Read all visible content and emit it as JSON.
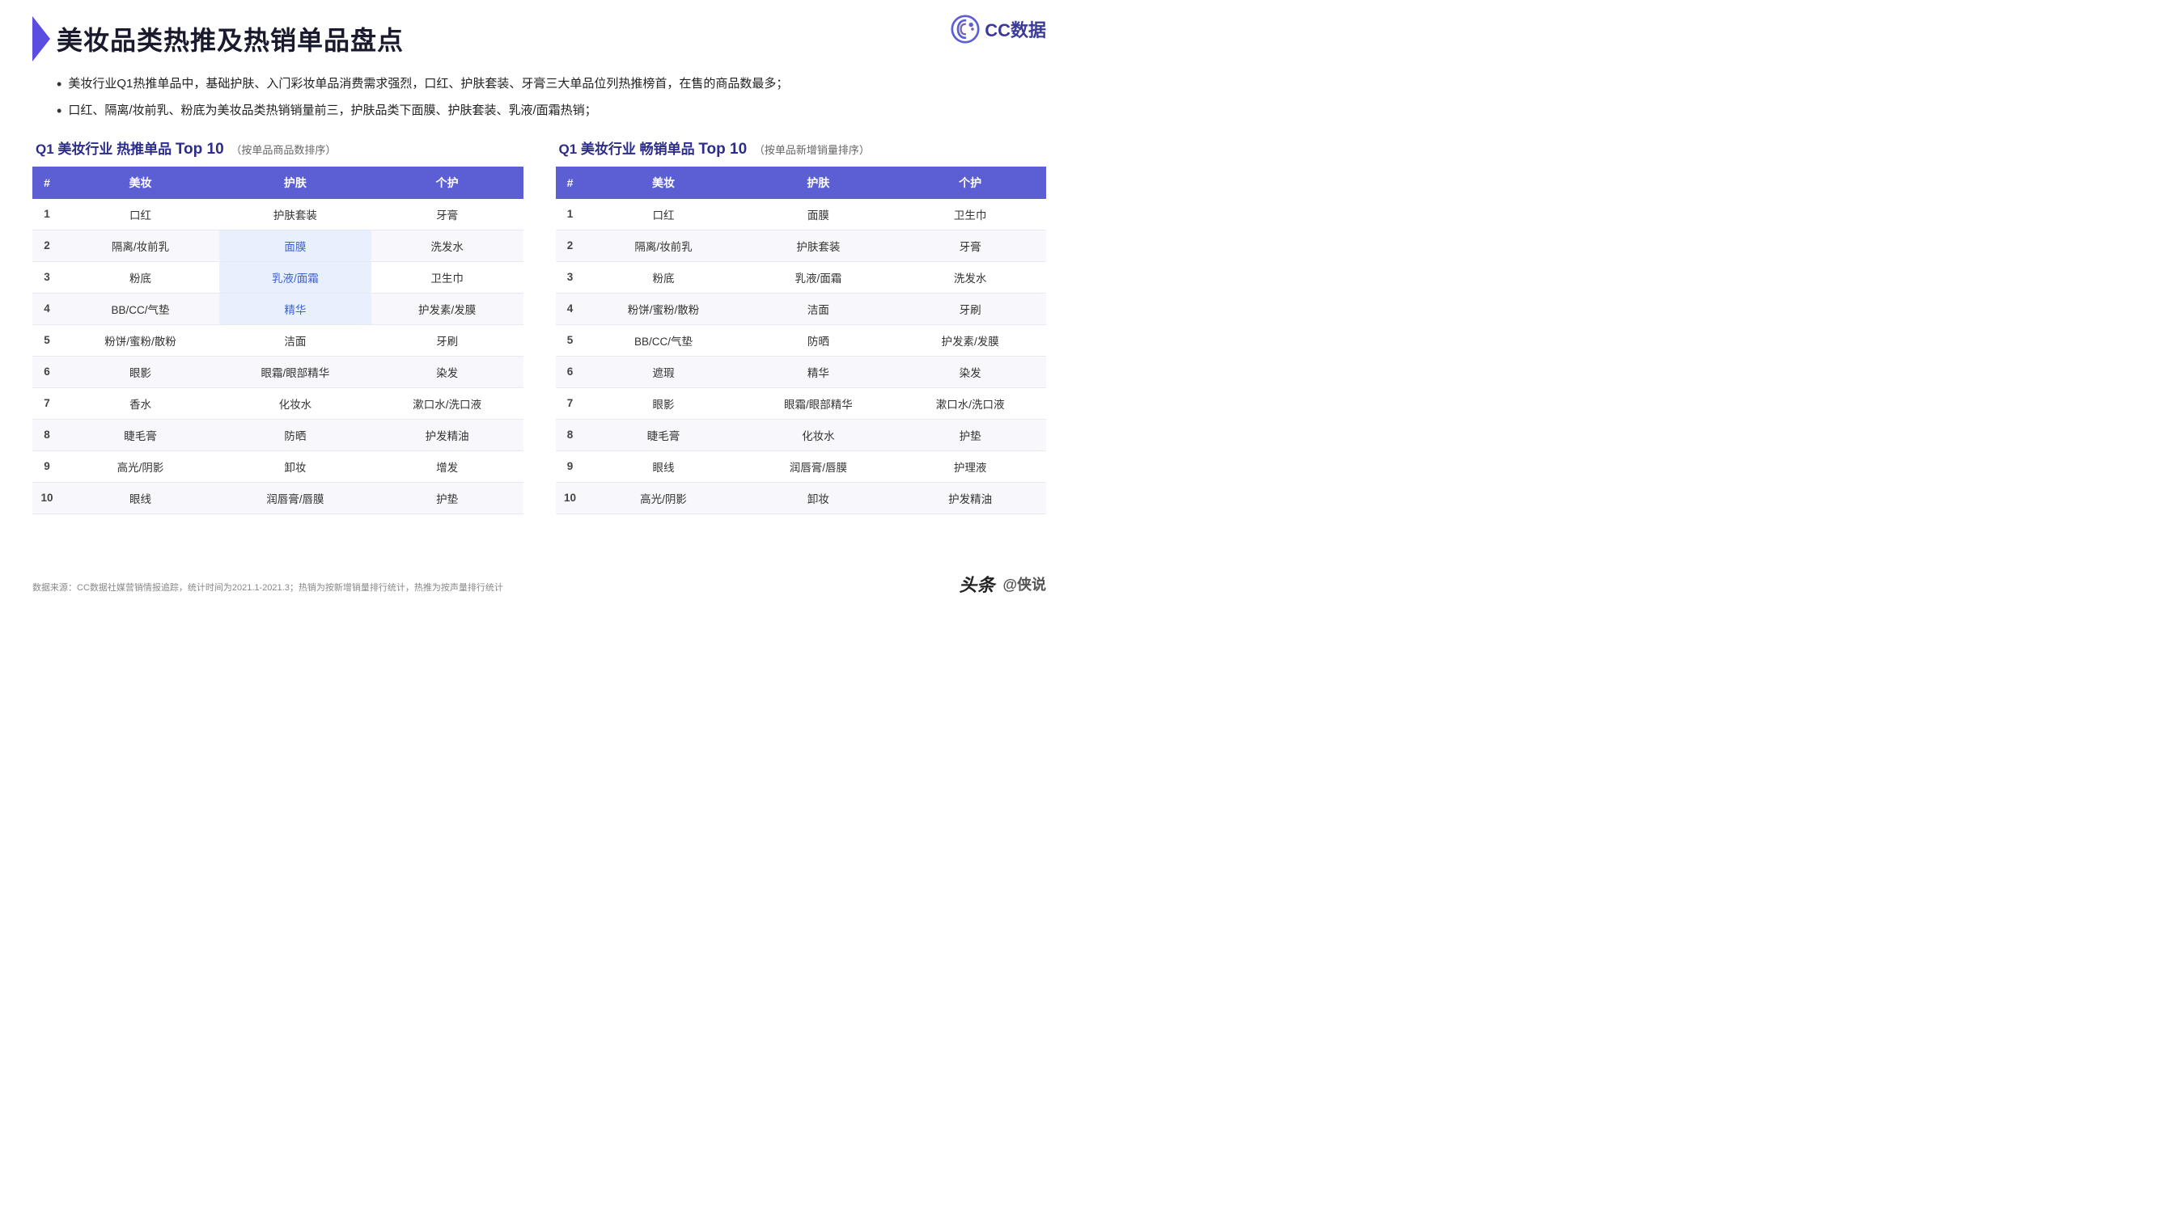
{
  "logo": {
    "text": "CC数据",
    "icon": "CC"
  },
  "title": "美妆品类热推及热销单品盘点",
  "bullets": [
    "美妆行业Q1热推单品中，基础护肤、入门彩妆单品消费需求强烈，口红、护肤套装、牙膏三大单品位列热推榜首，在售的商品数最多；",
    "口红、隔离/妆前乳、粉底为美妆品类热销销量前三，护肤品类下面膜、护肤套装、乳液/面霜热销；"
  ],
  "table1": {
    "title_prefix": "Q1 美妆行业 热推单品",
    "title_highlight": "Top 10",
    "title_sub": "（按单品商品数排序）",
    "headers": [
      "#",
      "美妆",
      "护肤",
      "个护"
    ],
    "rows": [
      {
        "rank": "1",
        "col1": "口红",
        "col2": "护肤套装",
        "col3": "牙膏",
        "highlight": []
      },
      {
        "rank": "2",
        "col1": "隔离/妆前乳",
        "col2": "面膜",
        "col3": "洗发水",
        "highlight": [
          "col2"
        ]
      },
      {
        "rank": "3",
        "col1": "粉底",
        "col2": "乳液/面霜",
        "col3": "卫生巾",
        "highlight": [
          "col2"
        ]
      },
      {
        "rank": "4",
        "col1": "BB/CC/气垫",
        "col2": "精华",
        "col3": "护发素/发膜",
        "highlight": [
          "col2"
        ]
      },
      {
        "rank": "5",
        "col1": "粉饼/蜜粉/散粉",
        "col2": "洁面",
        "col3": "牙刷",
        "highlight": []
      },
      {
        "rank": "6",
        "col1": "眼影",
        "col2": "眼霜/眼部精华",
        "col3": "染发",
        "highlight": []
      },
      {
        "rank": "7",
        "col1": "香水",
        "col2": "化妆水",
        "col3": "漱口水/洗口液",
        "highlight": []
      },
      {
        "rank": "8",
        "col1": "睫毛膏",
        "col2": "防晒",
        "col3": "护发精油",
        "highlight": []
      },
      {
        "rank": "9",
        "col1": "高光/阴影",
        "col2": "卸妆",
        "col3": "增发",
        "highlight": []
      },
      {
        "rank": "10",
        "col1": "眼线",
        "col2": "润唇膏/唇膜",
        "col3": "护垫",
        "highlight": []
      }
    ]
  },
  "table2": {
    "title_prefix": "Q1 美妆行业 畅销单品",
    "title_highlight": "Top 10",
    "title_sub": "（按单品新增销量排序）",
    "headers": [
      "#",
      "美妆",
      "护肤",
      "个护"
    ],
    "rows": [
      {
        "rank": "1",
        "col1": "口红",
        "col2": "面膜",
        "col3": "卫生巾",
        "highlight": []
      },
      {
        "rank": "2",
        "col1": "隔离/妆前乳",
        "col2": "护肤套装",
        "col3": "牙膏",
        "highlight": []
      },
      {
        "rank": "3",
        "col1": "粉底",
        "col2": "乳液/面霜",
        "col3": "洗发水",
        "highlight": []
      },
      {
        "rank": "4",
        "col1": "粉饼/蜜粉/散粉",
        "col2": "洁面",
        "col3": "牙刷",
        "highlight": []
      },
      {
        "rank": "5",
        "col1": "BB/CC/气垫",
        "col2": "防晒",
        "col3": "护发素/发膜",
        "highlight": []
      },
      {
        "rank": "6",
        "col1": "遮瑕",
        "col2": "精华",
        "col3": "染发",
        "highlight": []
      },
      {
        "rank": "7",
        "col1": "眼影",
        "col2": "眼霜/眼部精华",
        "col3": "漱口水/洗口液",
        "highlight": []
      },
      {
        "rank": "8",
        "col1": "睫毛膏",
        "col2": "化妆水",
        "col3": "护垫",
        "highlight": []
      },
      {
        "rank": "9",
        "col1": "眼线",
        "col2": "润唇膏/唇膜",
        "col3": "护理液",
        "highlight": []
      },
      {
        "rank": "10",
        "col1": "高光/阴影",
        "col2": "卸妆",
        "col3": "护发精油",
        "highlight": []
      }
    ]
  },
  "footer": {
    "source": "数据来源：CC数据社媒营销情报追踪，统计时间为2021.1-2021.3；热销为按新增销量排行统计，热推为按声量排行统计",
    "brand1": "头条",
    "brand2": "@侠说"
  }
}
